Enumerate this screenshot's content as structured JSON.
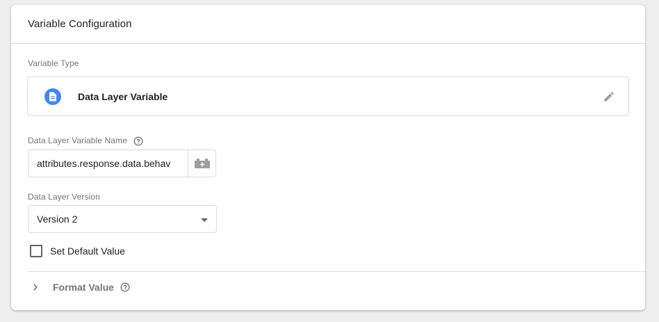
{
  "card": {
    "title": "Variable Configuration"
  },
  "variable_type": {
    "label": "Variable Type",
    "name": "Data Layer Variable",
    "icon": "document-icon",
    "icon_color": "#4285f4"
  },
  "dlv_name": {
    "label": "Data Layer Variable Name",
    "value": "attributes.response.data.behav",
    "picker_icon": "variable-brick-icon"
  },
  "dlv_version": {
    "label": "Data Layer Version",
    "selected": "Version 2"
  },
  "default_value": {
    "label": "Set Default Value",
    "checked": false
  },
  "format_value": {
    "label": "Format Value"
  }
}
